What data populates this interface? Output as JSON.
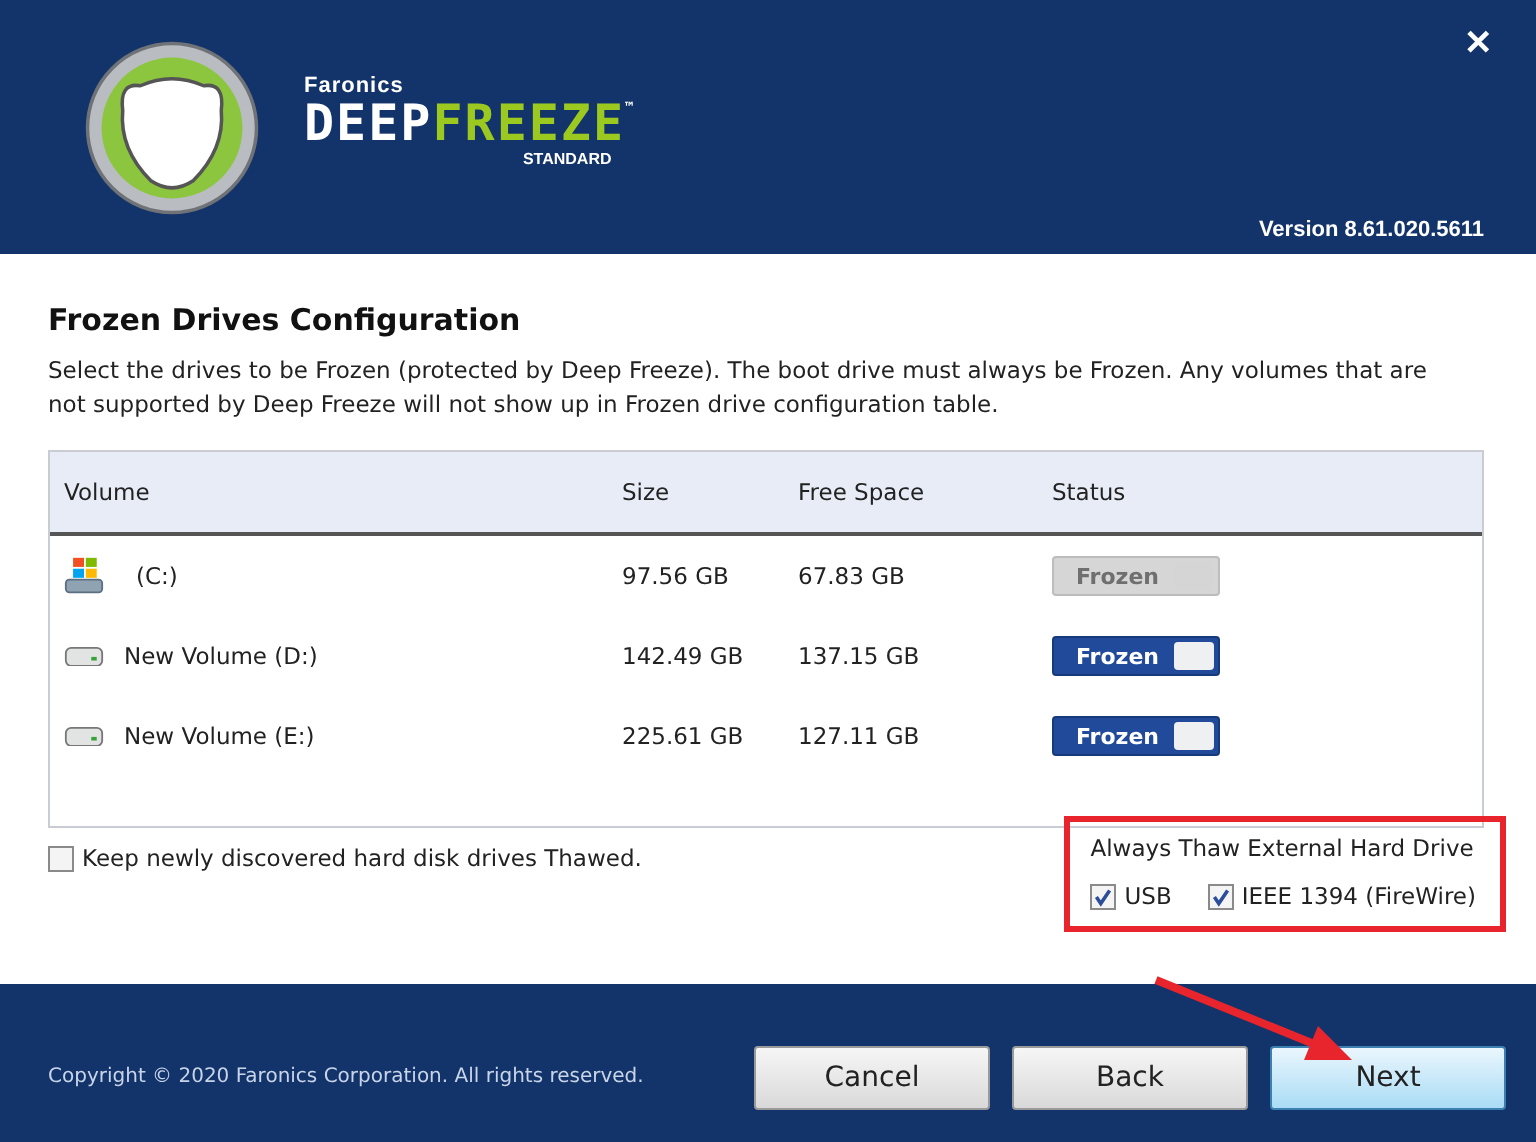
{
  "header": {
    "brand_small": "Faronics",
    "brand_first": "DEEP",
    "brand_second": "FREEZE",
    "brand_tm": "™",
    "edition": "STANDARD",
    "version": "Version 8.61.020.5611",
    "close": "✕"
  },
  "section": {
    "title": "Frozen Drives Configuration",
    "description": "Select the drives to be Frozen (protected by Deep Freeze). The boot drive must always be Frozen. Any volumes that are not supported by Deep Freeze will not show up in Frozen drive configuration table."
  },
  "table": {
    "columns": [
      "Volume",
      "Size",
      "Free Space",
      "Status"
    ],
    "rows": [
      {
        "kind": "system",
        "volume": "(C:)",
        "size": "97.56 GB",
        "free": "67.83 GB",
        "status": "Frozen",
        "disabled": true
      },
      {
        "kind": "disk",
        "volume": "New Volume (D:)",
        "size": "142.49 GB",
        "free": "137.15 GB",
        "status": "Frozen",
        "disabled": false
      },
      {
        "kind": "disk",
        "volume": "New Volume (E:)",
        "size": "225.61 GB",
        "free": "127.11 GB",
        "status": "Frozen",
        "disabled": false
      }
    ]
  },
  "keep_thawed": {
    "label": "Keep newly discovered hard disk drives Thawed.",
    "checked": false
  },
  "external": {
    "title": "Always Thaw External Hard Drive",
    "options": [
      {
        "label": "USB",
        "checked": true
      },
      {
        "label": "IEEE 1394 (FireWire)",
        "checked": true
      }
    ]
  },
  "footer": {
    "copyright": "Copyright © 2020  Faronics Corporation. All rights reserved.",
    "buttons": [
      {
        "label": "Cancel",
        "selected": false
      },
      {
        "label": "Back",
        "selected": false
      },
      {
        "label": "Next",
        "selected": true
      }
    ]
  }
}
